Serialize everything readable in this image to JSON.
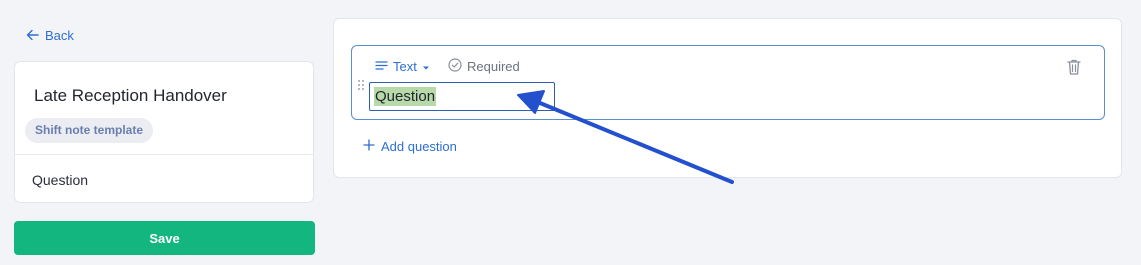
{
  "nav": {
    "back_label": "Back"
  },
  "template": {
    "title": "Late Reception Handover",
    "badge": "Shift note template",
    "items": [
      "Question"
    ]
  },
  "actions": {
    "save_label": "Save"
  },
  "question_editor": {
    "type_label": "Text",
    "required_label": "Required",
    "question_value": "Question",
    "add_question_label": "Add question"
  },
  "colors": {
    "accent": "#2d6fd0",
    "save_button": "#12b67e",
    "annotation_arrow": "#2350cc",
    "text_selection": "#b8d9a9"
  },
  "icons": {
    "back": "arrow-left-icon",
    "type": "lines-icon",
    "dropdown": "caret-down-icon",
    "required": "check-circle-icon",
    "delete": "trash-icon",
    "drag": "drag-handle-icon",
    "add": "plus-icon"
  }
}
